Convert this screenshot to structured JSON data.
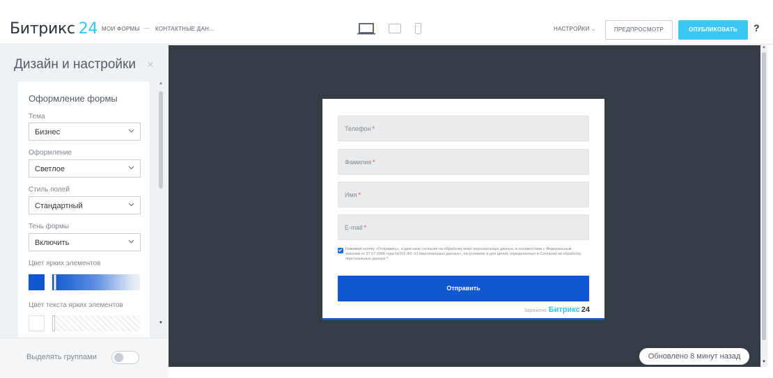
{
  "header": {
    "logo_text": "Битрикс",
    "logo_num": "24",
    "breadcrumb": [
      "МОИ ФОРМЫ",
      "КОНТАКТНЫЕ ДАН..."
    ],
    "breadcrumb_sep": "—",
    "devices": [
      "laptop-icon",
      "tablet-icon",
      "phone-icon"
    ],
    "settings_label": "НАСТРОЙКИ",
    "preview_label": "ПРЕДПРОСМОТР",
    "publish_label": "ОПУБЛИКОВАТЬ",
    "help_label": "?"
  },
  "sidebar": {
    "title": "Дизайн и настройки",
    "close_icon": "close-icon",
    "section_title": "Оформление формы",
    "fields": [
      {
        "label": "Тема",
        "value": "Бизнес"
      },
      {
        "label": "Оформление",
        "value": "Светлое"
      },
      {
        "label": "Стиль полей",
        "value": "Стандартный"
      },
      {
        "label": "Тень формы",
        "value": "Включить"
      }
    ],
    "accent_color_label": "Цвет ярких элементов",
    "accent_color": "#1058d0",
    "accent_text_color_label": "Цвет текста ярких элементов",
    "accent_text_color": "#ffffff",
    "group_toggle_label": "Выделять группами",
    "group_toggle_on": false
  },
  "form": {
    "fields": [
      {
        "placeholder": "Телефон",
        "required": "*"
      },
      {
        "placeholder": "Фамилия",
        "required": "*"
      },
      {
        "placeholder": "Имя",
        "required": "*"
      },
      {
        "placeholder": "E-mail",
        "required": "*"
      }
    ],
    "consent_checked": true,
    "consent_text": "Нажимая кнопку «Отправить», я даю свое согласие на обработку моих персональных данных, в соответствии с Федеральным законом от 27.07.2006 года №152-ФЗ «О персональных данных», на условиях и для целей, определенных в Согласии на обработку персональных данных",
    "consent_required": "*",
    "submit_label": "Отправить",
    "powered_prefix": "Заряжено",
    "powered_brand": "Битрикс",
    "powered_num": "24"
  },
  "status": {
    "updated_text": "Обновлено 8 минут назад"
  },
  "colors": {
    "brand_blue": "#2fc6f6",
    "canvas_bg": "#353c45",
    "form_accent": "#1058d0"
  }
}
